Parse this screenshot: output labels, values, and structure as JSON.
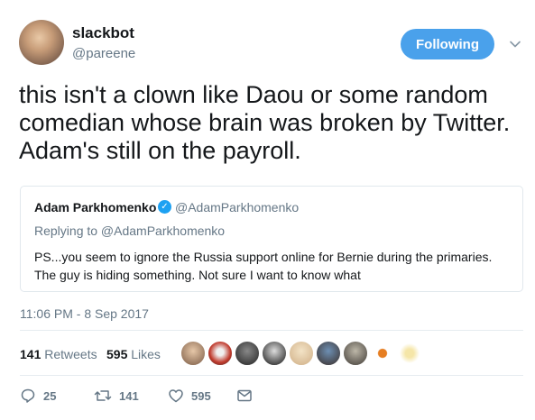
{
  "author": {
    "display_name": "slackbot",
    "handle": "@pareene"
  },
  "follow_button_label": "Following",
  "tweet_text": "this isn't a clown like Daou or some random comedian whose brain was broken by Twitter. Adam's still on the payroll.",
  "quoted_tweet": {
    "display_name": "Adam Parkhomenko",
    "handle": "@AdamParkhomenko",
    "replying_to": "Replying to @AdamParkhomenko",
    "text": "PS...you seem to ignore the Russia support online for Bernie during the primaries. The guy is hiding something. Not sure I want to know what"
  },
  "timestamp": "11:06 PM - 8 Sep 2017",
  "stats": {
    "retweets_count": "141",
    "retweets_label": "Retweets",
    "likes_count": "595",
    "likes_label": "Likes"
  },
  "actions": {
    "reply_count": "25",
    "retweet_count": "141",
    "like_count": "595"
  },
  "icons": [
    "chevron-down-icon",
    "verified-badge-icon",
    "reply-icon",
    "retweet-icon",
    "heart-icon",
    "message-icon"
  ],
  "colors": {
    "follow_button": "#4aa1eb",
    "verified": "#1da1f2",
    "secondary_text": "#657786",
    "primary_text": "#14171a"
  }
}
